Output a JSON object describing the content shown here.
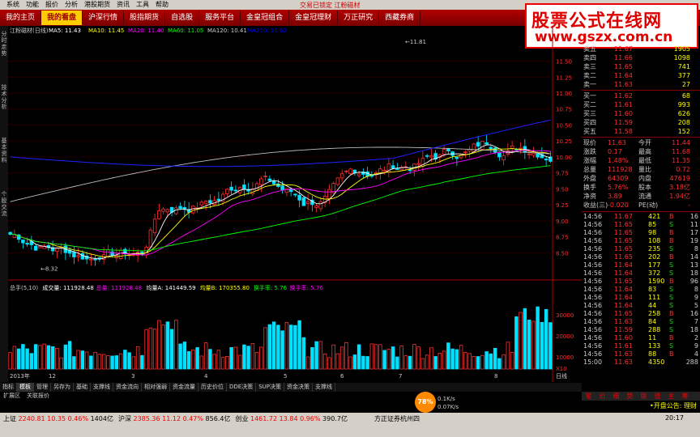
{
  "menubar": [
    "系统",
    "功能",
    "报价",
    "分析",
    "港股期货",
    "资讯",
    "工具",
    "帮助"
  ],
  "window_title": "交易已锁定  江粉磁材",
  "topnav": {
    "items": [
      "我的主页",
      "我的看盘",
      "沪深行情",
      "股指期货",
      "自选股",
      "服务平台",
      "金皇冠组合",
      "金皇冠理财",
      "万正研究",
      "西藏券商"
    ],
    "active": 1
  },
  "logo": {
    "line1": "股票公式在线网",
    "line2": "www.gszx.com.cn"
  },
  "sidetabs": [
    "分时走势",
    "技术分析",
    "基本资料",
    "个股交流"
  ],
  "chart_header": {
    "name": "江粉磁材(日线)",
    "ma": [
      {
        "label": "MA5: 11.43",
        "color": "#ffffff"
      },
      {
        "label": "MA10: 11.45",
        "color": "#ffff00"
      },
      {
        "label": "MA20: 11.40",
        "color": "#ff00ff"
      },
      {
        "label": "MA60: 11.05",
        "color": "#00ff00"
      },
      {
        "label": "MA120: 10.41",
        "color": "#cccccc"
      },
      {
        "label": "MA250: 10.62",
        "color": "#0000ff"
      }
    ]
  },
  "price_axis": [
    "11.50",
    "11.25",
    "11.00",
    "10.75",
    "10.50",
    "10.25",
    "10.00",
    "9.75",
    "9.50",
    "9.25",
    "9.00",
    "8.75",
    "8.50"
  ],
  "annotations": {
    "high": "11.81",
    "low": "8.32"
  },
  "volume_header": [
    {
      "label": "总手(5,10)",
      "color": "#cccccc"
    },
    {
      "label": "成交量: 111928.48",
      "color": "#ffffff"
    },
    {
      "label": "总量: 111928.48",
      "color": "#ff00ff"
    },
    {
      "label": "均量A: 141449.59",
      "color": "#ffffff"
    },
    {
      "label": "均量B: 170355.80",
      "color": "#ffff00"
    },
    {
      "label": "换手率: 5.76",
      "color": "#00ff00"
    },
    {
      "label": "换手率: 5.76",
      "color": "#ff00ff"
    }
  ],
  "volume_axis": [
    "30000",
    "20000",
    "10000"
  ],
  "volume_unit": "X10",
  "x_axis": [
    "2013年",
    "12",
    "3",
    "4",
    "5",
    "6",
    "7",
    "8"
  ],
  "period_label": "日线",
  "bottom_tabs": [
    "指标",
    "模板",
    "管理",
    "另存为",
    "基础",
    "支撑线",
    "资金流向",
    "相对强弱",
    "资金流量",
    "历史价位",
    "DDE决策",
    "SUP决策",
    "资金决策",
    "支撑线"
  ],
  "bottom_tabs_active": 1,
  "bottom_tabs2": [
    "扩展区",
    "关联报价"
  ],
  "orderbook": {
    "asks": [
      {
        "label": "卖五",
        "price": "11.67",
        "vol": "1905"
      },
      {
        "label": "卖四",
        "price": "11.66",
        "vol": "1098"
      },
      {
        "label": "卖三",
        "price": "11.65",
        "vol": "741"
      },
      {
        "label": "卖二",
        "price": "11.64",
        "vol": "377"
      },
      {
        "label": "卖一",
        "price": "11.63",
        "vol": "27"
      }
    ],
    "bids": [
      {
        "label": "买一",
        "price": "11.62",
        "vol": "68"
      },
      {
        "label": "买二",
        "price": "11.61",
        "vol": "993"
      },
      {
        "label": "买三",
        "price": "11.60",
        "vol": "626"
      },
      {
        "label": "买四",
        "price": "11.59",
        "vol": "208"
      },
      {
        "label": "买五",
        "price": "11.58",
        "vol": "152"
      }
    ]
  },
  "stats": [
    {
      "k1": "现价",
      "v1": "11.63",
      "k2": "今开",
      "v2": "11.44"
    },
    {
      "k1": "涨跌",
      "v1": "0.17",
      "k2": "最高",
      "v2": "11.68"
    },
    {
      "k1": "涨幅",
      "v1": "1.48%",
      "k2": "最低",
      "v2": "11.35"
    },
    {
      "k1": "总量",
      "v1": "111928",
      "k2": "量比",
      "v2": "0.72"
    },
    {
      "k1": "外盘",
      "v1": "64309",
      "k2": "内盘",
      "v2": "47619"
    },
    {
      "k1": "换手",
      "v1": "5.76%",
      "k2": "股本",
      "v2": "3.18亿"
    },
    {
      "k1": "净资",
      "v1": "3.89",
      "k2": "流通",
      "v2": "1.94亿"
    },
    {
      "k1": "收益(三)",
      "v1": "-0.020",
      "k2": "PE(动)",
      "v2": "-"
    }
  ],
  "ticks": [
    {
      "t": "14:56",
      "p": "11.67",
      "v": "421",
      "d": "B",
      "n": "16"
    },
    {
      "t": "14:56",
      "p": "11.65",
      "v": "85",
      "d": "S",
      "n": "11"
    },
    {
      "t": "14:56",
      "p": "11.65",
      "v": "98",
      "d": "B",
      "n": "17"
    },
    {
      "t": "14:56",
      "p": "11.65",
      "v": "108",
      "d": "B",
      "n": "19"
    },
    {
      "t": "14:56",
      "p": "11.65",
      "v": "235",
      "d": "S",
      "n": "8"
    },
    {
      "t": "14:56",
      "p": "11.65",
      "v": "202",
      "d": "B",
      "n": "14"
    },
    {
      "t": "14:56",
      "p": "11.64",
      "v": "177",
      "d": "S",
      "n": "13"
    },
    {
      "t": "14:56",
      "p": "11.64",
      "v": "372",
      "d": "S",
      "n": "18"
    },
    {
      "t": "14:56",
      "p": "11.65",
      "v": "1590",
      "d": "B",
      "n": "96"
    },
    {
      "t": "14:56",
      "p": "11.64",
      "v": "83",
      "d": "S",
      "n": "8"
    },
    {
      "t": "14:56",
      "p": "11.64",
      "v": "111",
      "d": "S",
      "n": "9"
    },
    {
      "t": "14:56",
      "p": "11.64",
      "v": "44",
      "d": "S",
      "n": "5"
    },
    {
      "t": "14:56",
      "p": "11.65",
      "v": "258",
      "d": "B",
      "n": "16"
    },
    {
      "t": "14:56",
      "p": "11.63",
      "v": "84",
      "d": "S",
      "n": "7"
    },
    {
      "t": "14:56",
      "p": "11.59",
      "v": "288",
      "d": "S",
      "n": "18"
    },
    {
      "t": "14:56",
      "p": "11.60",
      "v": "11",
      "d": "B",
      "n": "2"
    },
    {
      "t": "14:56",
      "p": "11.61",
      "v": "133",
      "d": "S",
      "n": "9"
    },
    {
      "t": "14:56",
      "p": "11.63",
      "v": "88",
      "d": "B",
      "n": "4"
    },
    {
      "t": "15:00",
      "p": "11.63",
      "v": "4350",
      "d": "",
      "n": "288"
    }
  ],
  "right_tabs": [
    "笔",
    "价",
    "细",
    "势",
    "联",
    "值",
    "主",
    "筹"
  ],
  "badge": "78%",
  "net_speed": {
    "up": "0.1K/s",
    "down": "0.07K/s"
  },
  "status": {
    "sh": {
      "name": "上证",
      "val": "2240.81",
      "chg": "10.35",
      "pct": "0.46%",
      "amt": "1404亿"
    },
    "hs": {
      "name": "沪深",
      "val": "2385.36",
      "chg": "11.12",
      "pct": "0.47%",
      "amt": "856.4亿"
    },
    "cy": {
      "name": "创业",
      "val": "1461.72",
      "chg": "13.84",
      "pct": "0.96%",
      "amt": "390.7亿"
    },
    "broker": "方正证券杭州四",
    "time": "20:17",
    "ticker": "•开盘公告: 理财"
  },
  "chart_data": {
    "type": "candlestick",
    "ylim": [
      8.25,
      11.9
    ],
    "note_ma": [
      "MA5",
      "MA10",
      "MA20",
      "MA60",
      "MA120",
      "MA250"
    ],
    "colors": {
      "up": "#ff3030",
      "down": "#00e0ff"
    }
  }
}
